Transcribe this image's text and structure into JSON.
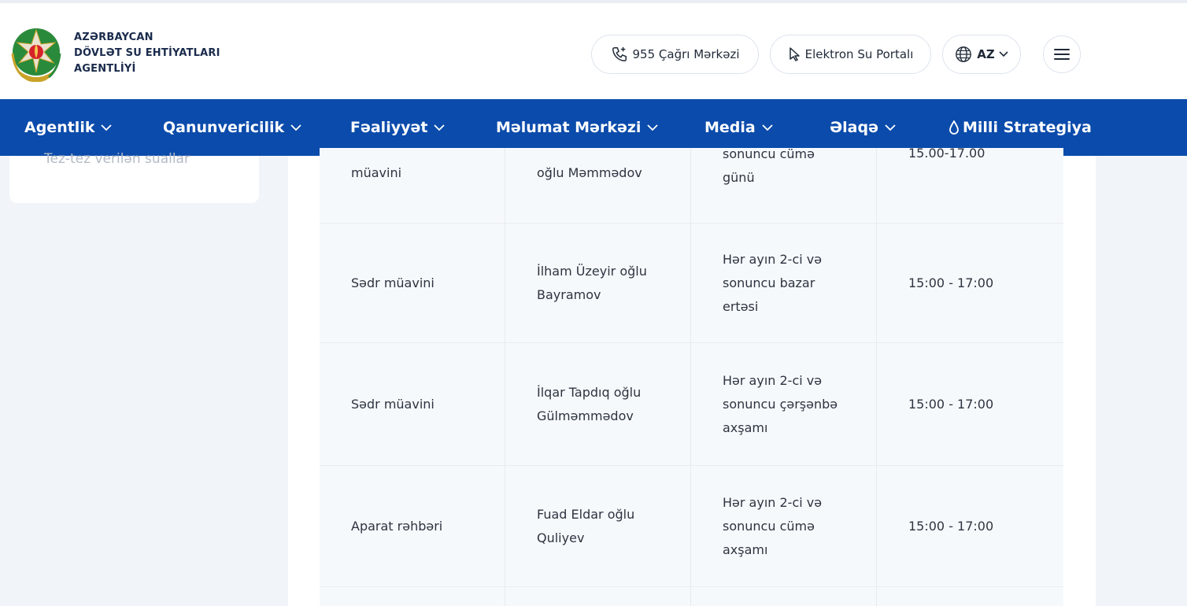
{
  "header": {
    "logo_lines": [
      "AZƏRBAYCAN",
      "DÖVLƏT SU EHTİYATLARI",
      "AGENTLİYİ"
    ],
    "call_center": "955 Çağrı Mərkəzi",
    "portal": "Elektron Su Portalı",
    "language": "AZ",
    "icons": {
      "call": "phone-plus-icon",
      "portal": "cursor-pointer-icon",
      "language": "globe-icon",
      "menu": "hamburger-icon"
    }
  },
  "nav": {
    "items": [
      {
        "label": "Agentlik"
      },
      {
        "label": "Qanunvericilik"
      },
      {
        "label": "Fəaliyyət"
      },
      {
        "label": "Məlumat Mərkəzi"
      },
      {
        "label": "Media"
      },
      {
        "label": "Əlaqə"
      },
      {
        "label": "Milli Strategiya"
      }
    ]
  },
  "sidebar": {
    "faq_label": "Tez-tez verilən suallar"
  },
  "table": {
    "rows": [
      {
        "position": "müavini",
        "name": "oğlu Məmmədov",
        "schedule": "sonuncu cümə günü",
        "time": "15.00-17.00"
      },
      {
        "position": "Sədr müavini",
        "name": "İlham Üzeyir oğlu Bayramov",
        "schedule": "Hər ayın 2-ci və sonuncu bazar ertəsi",
        "time": "15:00 - 17:00"
      },
      {
        "position": "Sədr müavini",
        "name": "İlqar Tapdıq oğlu Gülməmmədov",
        "schedule": "Hər ayın 2-ci və sonuncu çərşənbə axşamı",
        "time": "15:00 - 17:00"
      },
      {
        "position": "Aparat rəhbəri",
        "name": "Fuad Eldar oğlu Quliyev",
        "schedule": "Hər ayın 2-ci və sonuncu cümə axşamı",
        "time": "15:00 - 17:00"
      }
    ]
  },
  "colors": {
    "nav_bg": "#0b4bab",
    "page_bg": "#f1f4f9",
    "row_bg": "#f6f9fc"
  }
}
